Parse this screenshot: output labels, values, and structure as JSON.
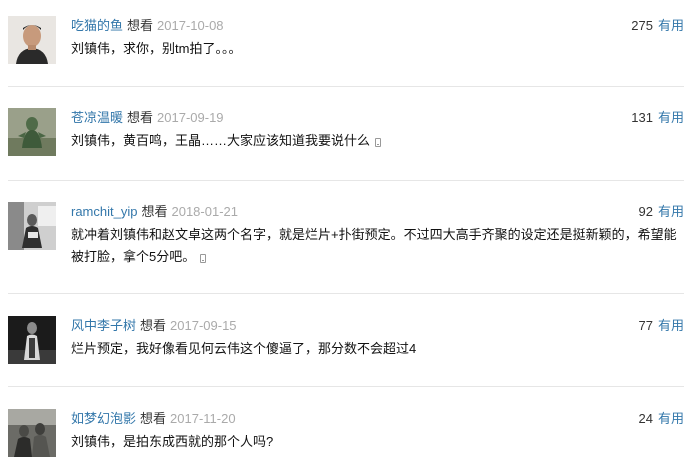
{
  "comments": [
    {
      "username": "吃猫的鱼",
      "status": "想看",
      "date": "2017-10-08",
      "votes": "275",
      "useful": "有用",
      "text": "刘镇伟，求你，别tm拍了。。。",
      "mobile": false
    },
    {
      "username": "苍凉温暖",
      "status": "想看",
      "date": "2017-09-19",
      "votes": "131",
      "useful": "有用",
      "text": "刘镇伟，黄百鸣，王晶……大家应该知道我要说什么",
      "mobile": true
    },
    {
      "username": "ramchit_yip",
      "status": "想看",
      "date": "2018-01-21",
      "votes": "92",
      "useful": "有用",
      "text": "就冲着刘镇伟和赵文卓这两个名字，就是烂片+扑街预定。不过四大高手齐聚的设定还是挺新颖的，希望能被打脸，拿个5分吧。",
      "mobile": true
    },
    {
      "username": "风中李子树",
      "status": "想看",
      "date": "2017-09-15",
      "votes": "77",
      "useful": "有用",
      "text": "烂片预定，我好像看见何云伟这个傻逼了，那分数不会超过4",
      "mobile": false
    },
    {
      "username": "如梦幻泡影",
      "status": "想看",
      "date": "2017-11-20",
      "votes": "24",
      "useful": "有用",
      "text": "刘镇伟，是拍东成西就的那个人吗?",
      "mobile": false
    }
  ],
  "colors": {
    "link": "#3377aa",
    "date": "#aaaaaa",
    "divider": "#e6e6e6",
    "text": "#111111"
  },
  "icons": {
    "mobile": "mobile-phone-icon"
  }
}
